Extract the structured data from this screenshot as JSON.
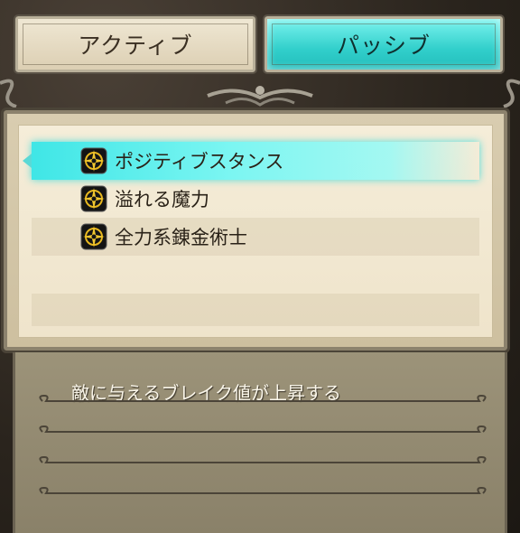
{
  "tabs": {
    "active_label": "アクティブ",
    "passive_label": "パッシブ"
  },
  "skills": [
    {
      "label": "ポジティブスタンス",
      "icon": "compass-icon",
      "selected": true
    },
    {
      "label": "溢れる魔力",
      "icon": "compass-icon",
      "selected": false
    },
    {
      "label": "全力系錬金術士",
      "icon": "compass-icon",
      "selected": false
    }
  ],
  "description": {
    "text": "敵に与えるブレイク値が上昇する"
  },
  "colors": {
    "selected_highlight": "#3fe6e6",
    "active_tab": "#31cfcb",
    "panel_parchment": "#f5edd9",
    "description_bg": "#9c9379"
  }
}
